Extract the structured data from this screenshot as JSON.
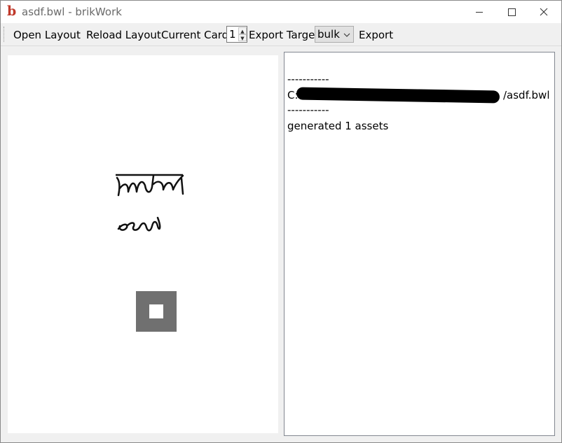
{
  "window": {
    "title": "asdf.bwl - brikWork",
    "app_icon": "b"
  },
  "toolbar": {
    "open_layout": "Open Layout",
    "reload_layout": "Reload Layout",
    "current_card_label": "Current Card",
    "current_card_value": "1",
    "export_target_label": "Export Target",
    "export_target_value": "bulk",
    "export": "Export"
  },
  "log": {
    "lines": [
      "-----------",
      "C:",
      "/asdf.bwl",
      "-----------",
      "generated 1 assets"
    ]
  },
  "colors": {
    "accent_icon": "#c0392b",
    "shape_fill": "#707070"
  }
}
